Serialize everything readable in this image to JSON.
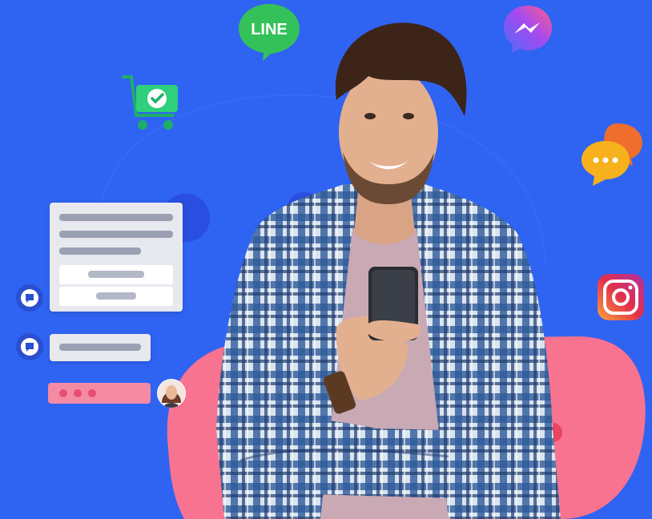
{
  "scene": {
    "description_label": "",
    "colors": {
      "background": "#2f63f2",
      "pink_blob": "#f7738f",
      "line_green": "#35c159",
      "chat_yellow": "#f7b11c",
      "chat_orange": "#ef6d2d",
      "cart_green": "#2fcf7b"
    }
  },
  "icons": {
    "line": {
      "label": "LINE",
      "icon": "line-chat-icon"
    },
    "messenger": {
      "icon": "messenger-icon"
    },
    "cart": {
      "icon": "shopping-cart-check-icon"
    },
    "chat": {
      "icon": "chat-bubbles-icon"
    },
    "instagram": {
      "icon": "instagram-icon"
    }
  },
  "chat_ui": {
    "bot_icon": "bot-avatar-icon",
    "typing_indicator": "typing-dots-icon",
    "user_icon": "user-avatar-icon"
  }
}
